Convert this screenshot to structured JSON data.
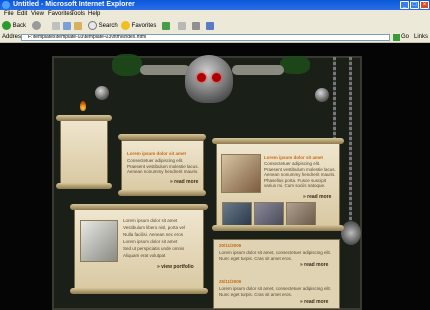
{
  "window": {
    "title": "Untitled - Microsoft Internet Explorer",
    "buttons": {
      "minimize": "_",
      "maximize": "□",
      "close": "×"
    }
  },
  "menu": [
    "File",
    "Edit",
    "View",
    "Favorites",
    "Tools",
    "Help"
  ],
  "toolbar": {
    "back": "Back",
    "search": "Search",
    "favorites": "Favorites"
  },
  "address": {
    "label": "Address",
    "url": "F:\\templates\\template-03\\template-03\\html\\index.html",
    "go": "Go",
    "links": "Links"
  },
  "page": {
    "welcome": {
      "heading": "Lorem ipsum dolor sit amet",
      "body": "Consectetuer adipiscing elit. Praesent vestibulum molestie lacus. Aenean nonummy hendrerit mauris.",
      "more": "» read more"
    },
    "gallery": {
      "heading": "Lorem ipsum dolor sit amet",
      "body": "Consectetuer adipiscing elit. Praesent vestibulum molestie lacus. Aenean nonummy hendrerit mauris. Phasellus porta. Fusce suscipit varius mi. Cum sociis natoque.",
      "more": "» read more"
    },
    "portfolio": {
      "items": [
        "Lorem ipsum dolor sit amet",
        "Vestibulum libero nisl, porta vel",
        "Nulla facilisi. Aenean nec eros",
        "Lorem ipsum dolor sit amet",
        "Sed ut perspiciatis unde omnis",
        "Aliquam erat volutpat"
      ],
      "more": "» view portfolio"
    },
    "news": [
      {
        "date": "20/11/2006",
        "text": "Lorem ipsum dolor sit amet, consectetuer adipiscing elit. Nunc eget turpis. Cras sit amet eros."
      },
      {
        "date": "25/11/2006",
        "text": "Lorem ipsum dolor sit amet, consectetuer adipiscing elit. Nunc eget turpis. Cras sit amet eros."
      }
    ],
    "news_more": "» read more"
  }
}
